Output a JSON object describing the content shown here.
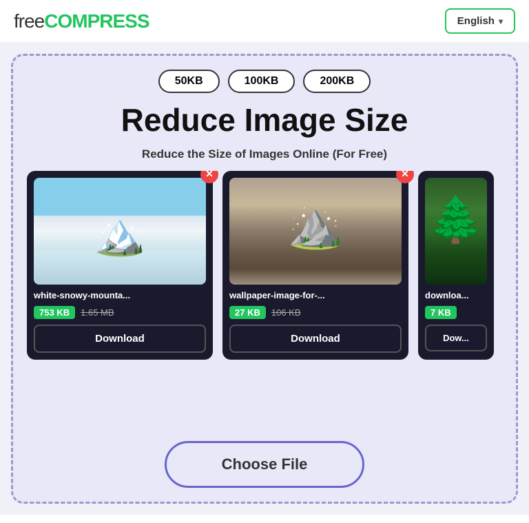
{
  "header": {
    "logo_free": "free",
    "logo_compress": "COMPRESS",
    "lang_label": "English",
    "lang_chevron": "▾"
  },
  "size_pills": [
    "50KB",
    "100KB",
    "200KB"
  ],
  "main_title": "Reduce Image Size",
  "main_subtitle": "Reduce the Size of Images Online (For Free)",
  "cards": [
    {
      "filename": "white-snowy-mounta...",
      "size_compressed": "753 KB",
      "size_original": "1.65 MB",
      "download_label": "Download",
      "img_type": "snow"
    },
    {
      "filename": "wallpaper-image-for-...",
      "size_compressed": "27 KB",
      "size_original": "106 KB",
      "download_label": "Download",
      "img_type": "mountains"
    },
    {
      "filename": "downloa...",
      "size_compressed": "7 KB",
      "size_original": "",
      "download_label": "Dow...",
      "img_type": "forest"
    }
  ],
  "choose_file_label": "Choose File",
  "close_icon": "✕"
}
